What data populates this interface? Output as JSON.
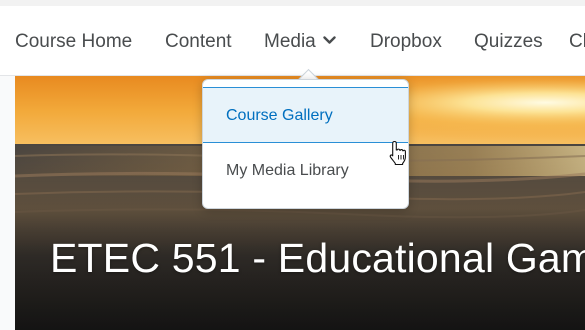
{
  "nav": {
    "items": [
      {
        "label": "Course Home"
      },
      {
        "label": "Content"
      },
      {
        "label": "Media"
      },
      {
        "label": "Dropbox"
      },
      {
        "label": "Quizzes"
      },
      {
        "label": "Cl"
      }
    ]
  },
  "media_menu": {
    "items": [
      {
        "label": "Course Gallery",
        "state": "hover"
      },
      {
        "label": "My Media Library"
      }
    ]
  },
  "banner": {
    "title": "ETEC 551 - Educational Gam"
  },
  "icons": {
    "media_chevron": "chevron-down-icon",
    "pointer": "hand-pointer-cursor"
  },
  "colors": {
    "nav_text": "#494c4e",
    "menu_active_text": "#006fbf",
    "menu_active_bg": "#e8f3fa",
    "menu_active_border": "#2a8fd6"
  }
}
